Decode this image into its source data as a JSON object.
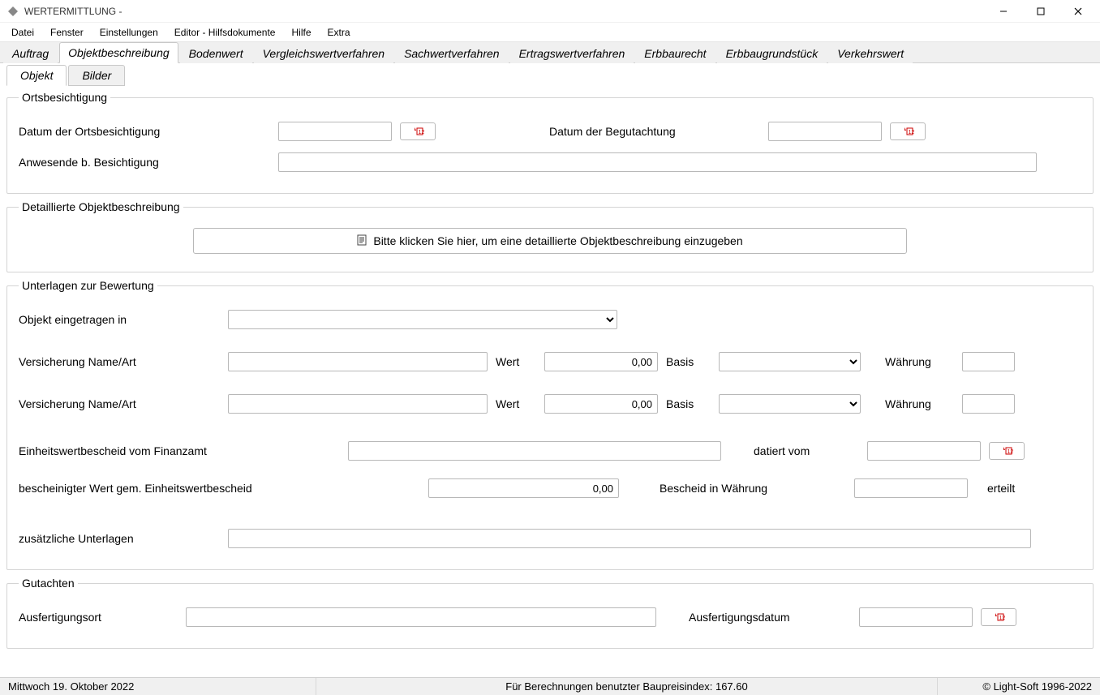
{
  "window": {
    "title": "WERTERMITTLUNG -"
  },
  "menu": {
    "items": [
      "Datei",
      "Fenster",
      "Einstellungen",
      "Editor - Hilfsdokumente",
      "Hilfe",
      "Extra"
    ]
  },
  "main_tabs": {
    "items": [
      "Auftrag",
      "Objektbeschreibung",
      "Bodenwert",
      "Vergleichswertverfahren",
      "Sachwertverfahren",
      "Ertragswertverfahren",
      "Erbbaurecht",
      "Erbbaugrundstück",
      "Verkehrswert"
    ],
    "active_index": 1
  },
  "sub_tabs": {
    "items": [
      "Objekt",
      "Bilder"
    ],
    "active_index": 0
  },
  "ortsbesichtigung": {
    "legend": "Ortsbesichtigung",
    "datum_orts_label": "Datum der Ortsbesichtigung",
    "datum_orts_value": "",
    "datum_begut_label": "Datum der Begutachtung",
    "datum_begut_value": "",
    "anwesende_label": "Anwesende b. Besichtigung",
    "anwesende_value": ""
  },
  "detailbeschreibung": {
    "legend": "Detaillierte Objektbeschreibung",
    "button_label": "Bitte klicken Sie hier, um eine detaillierte Objektbeschreibung einzugeben"
  },
  "unterlagen": {
    "legend": "Unterlagen zur Bewertung",
    "objekt_eingetragen_label": "Objekt eingetragen in",
    "objekt_eingetragen_value": "",
    "vers1": {
      "label": "Versicherung Name/Art",
      "name": "",
      "wert_label": "Wert",
      "wert": "0,00",
      "basis_label": "Basis",
      "basis": "",
      "waehrung_label": "Währung",
      "waehrung": ""
    },
    "vers2": {
      "label": "Versicherung Name/Art",
      "name": "",
      "wert_label": "Wert",
      "wert": "0,00",
      "basis_label": "Basis",
      "basis": "",
      "waehrung_label": "Währung",
      "waehrung": ""
    },
    "einheitswert_label": "Einheitswertbescheid vom Finanzamt",
    "einheitswert_value": "",
    "datiert_label": "datiert vom",
    "datiert_value": "",
    "bescheinigt_label": "bescheinigter Wert gem. Einheitswertbescheid",
    "bescheinigt_value": "0,00",
    "bescheid_waehrung_label": "Bescheid in Währung",
    "bescheid_waehrung_value": "",
    "erteilt_label": "erteilt",
    "zusatz_label": "zusätzliche Unterlagen",
    "zusatz_value": ""
  },
  "gutachten": {
    "legend": "Gutachten",
    "ort_label": "Ausfertigungsort",
    "ort_value": "",
    "datum_label": "Ausfertigungsdatum",
    "datum_value": ""
  },
  "status": {
    "date": "Mittwoch  19. Oktober  2022",
    "center": "Für Berechnungen benutzter Baupreisindex: 167.60",
    "copyright": "© Light-Soft 1996-2022"
  }
}
